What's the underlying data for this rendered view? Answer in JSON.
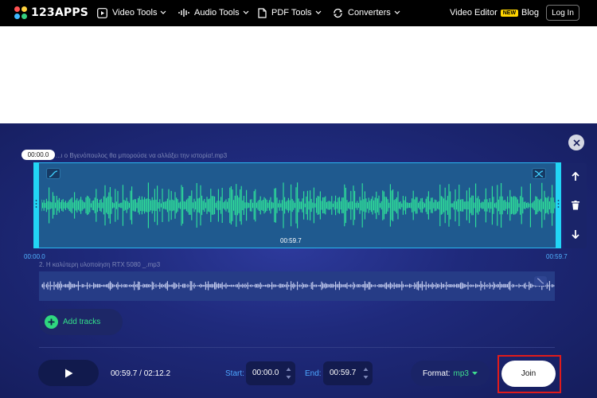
{
  "nav": {
    "brand": "123APPS",
    "items": [
      {
        "label": "Video Tools",
        "icon": "play-square-icon"
      },
      {
        "label": "Audio Tools",
        "icon": "audio-wave-icon"
      },
      {
        "label": "PDF Tools",
        "icon": "document-icon"
      },
      {
        "label": "Converters",
        "icon": "convert-cycle-icon"
      }
    ],
    "video_editor": "Video Editor",
    "new_badge": "NEW",
    "blog": "Blog",
    "login": "Log In"
  },
  "editor": {
    "tracks": [
      {
        "index": "",
        "name": "...ι ο Βγενόπουλος θα μπορούσε να αλλάξει την ιστορία!.mp3",
        "duration": "00:59.7",
        "cursor_time": "00:00.0",
        "start": "00:00.0",
        "end": "00:59.7"
      },
      {
        "index": "2",
        "name": "2. Η καλύτερη υλοποίηση RTX 5080 _.mp3"
      }
    ],
    "add_tracks": "Add tracks",
    "player": {
      "time": "00:59.7 / 02:12.2",
      "start_label": "Start:",
      "start_value": "00:00.0",
      "end_label": "End:",
      "end_value": "00:59.7",
      "format_label": "Format:",
      "format_value": "mp3",
      "join": "Join"
    }
  },
  "colors": {
    "nav_bg": "#000000",
    "editor_bg": "#1f2a7c",
    "wave_main": "#2fe39a",
    "accent_cyan": "#22d5f5",
    "highlight_red": "#e11b1b"
  }
}
